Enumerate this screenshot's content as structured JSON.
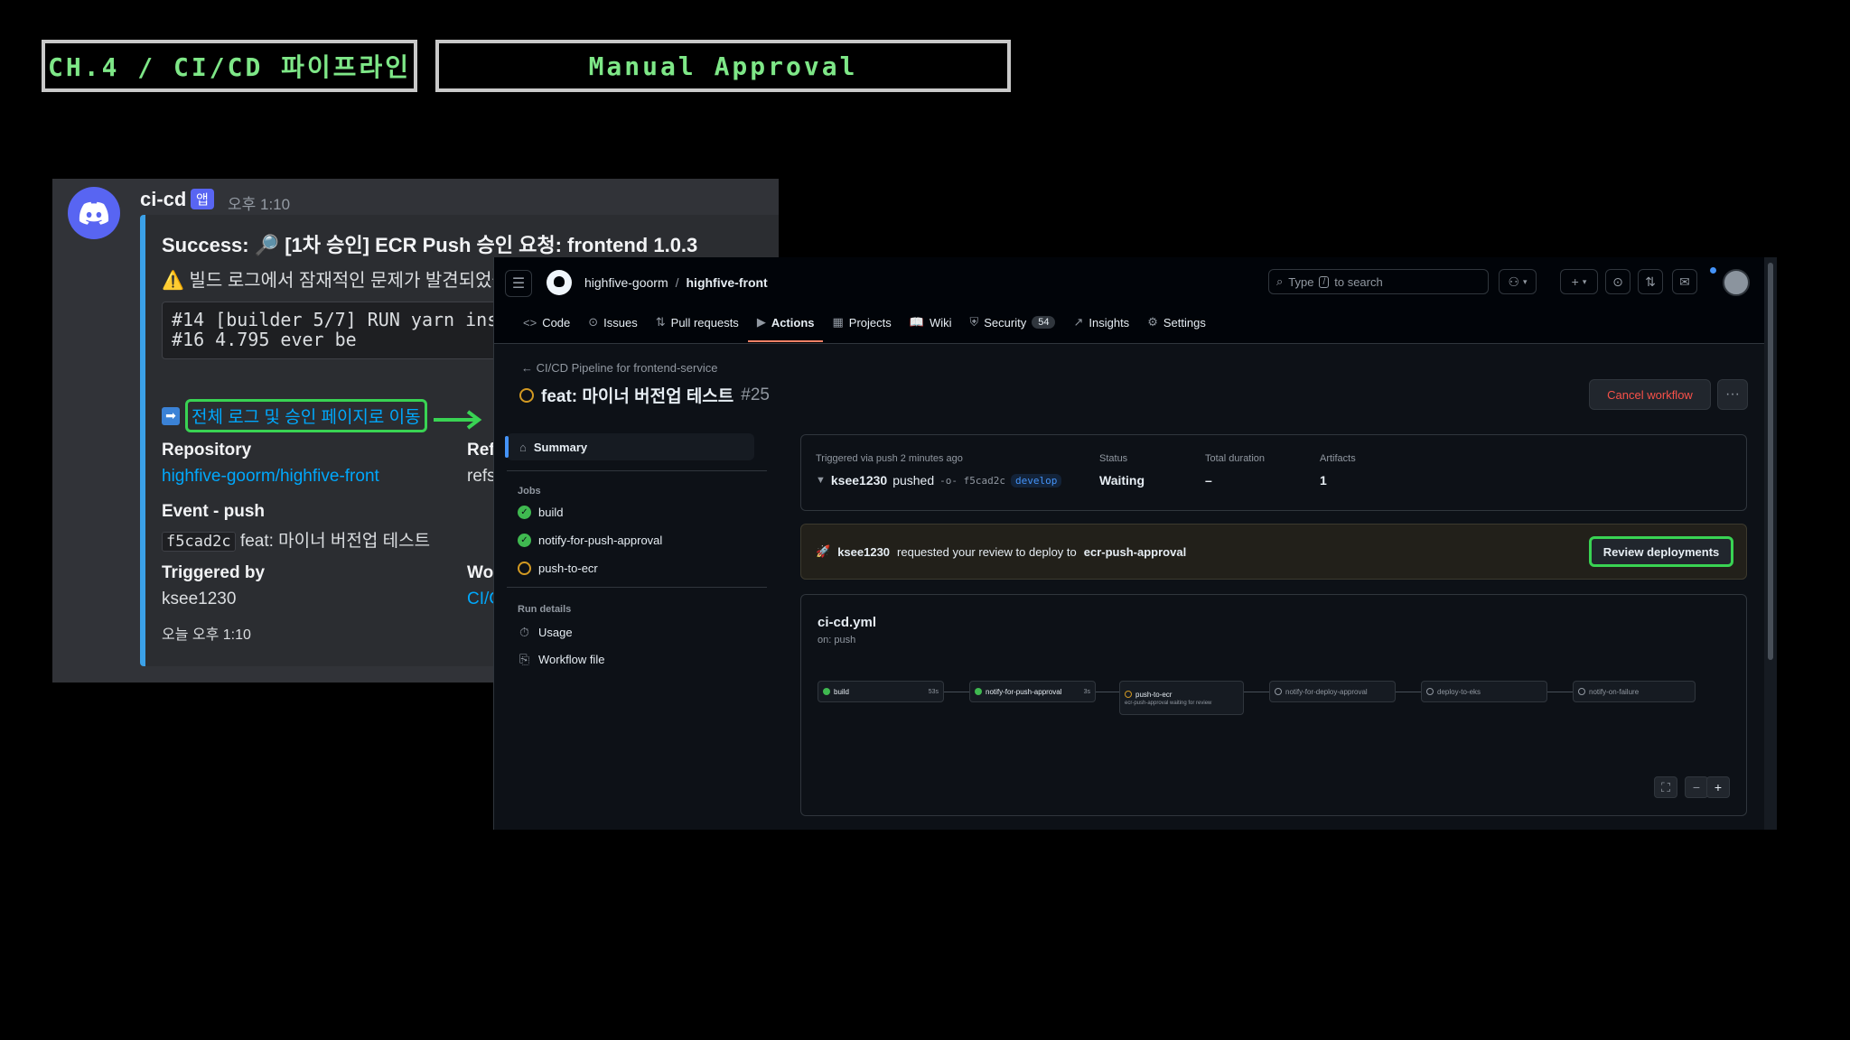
{
  "tags": {
    "chapter": "CH.4 / CI/CD 파이프라인",
    "topic": "Manual Approval"
  },
  "discord": {
    "author": "ci-cd",
    "badge": "앱",
    "time": "오후 1:10",
    "embed": {
      "title": "Success: 🔎 [1차 승인] ECR Push 승인 요청: frontend 1.0.3",
      "warning": "빌드 로그에서 잠재적인 문제가 발견되었습니",
      "code_line1": "#14 [builder 5/7] RUN yarn ins",
      "code_line2": "#16 4.795 ever be",
      "link_text": "전체 로그 및 승인 페이지로 이동",
      "repository_label": "Repository",
      "repository_value": "highfive-goorm/highfive-front",
      "ref_label": "Ref",
      "ref_value": "refs",
      "event_label": "Event - push",
      "commit_sha": "f5cad2c",
      "commit_msg": "feat: 마이너 버전업 테스트",
      "triggered_label": "Triggered by",
      "triggered_value": "ksee1230",
      "workflow_label": "Wor",
      "workflow_value": "CI/C",
      "footer": "오늘 오후 1:10"
    }
  },
  "github": {
    "owner": "highfive-goorm",
    "repo": "highfive-front",
    "search_placeholder": "Type",
    "search_key": "/",
    "search_suffix": "to search",
    "tabs": [
      {
        "label": "Code",
        "icon": "<>"
      },
      {
        "label": "Issues",
        "icon": "⊙"
      },
      {
        "label": "Pull requests",
        "icon": "⇅"
      },
      {
        "label": "Actions",
        "icon": "▶"
      },
      {
        "label": "Projects",
        "icon": "▦"
      },
      {
        "label": "Wiki",
        "icon": "📖"
      },
      {
        "label": "Security",
        "icon": "⛨",
        "counter": "54"
      },
      {
        "label": "Insights",
        "icon": "↗"
      },
      {
        "label": "Settings",
        "icon": "⚙"
      }
    ],
    "back_link": "CI/CD Pipeline for frontend-service",
    "run_title": "feat: 마이너 버전업 테스트",
    "run_number": "#25",
    "cancel_label": "Cancel workflow",
    "more_label": "···",
    "sidebar": {
      "summary": "Summary",
      "jobs_head": "Jobs",
      "jobs": [
        "build",
        "notify-for-push-approval",
        "push-to-ecr"
      ],
      "details_head": "Run details",
      "usage": "Usage",
      "workflow_file": "Workflow file"
    },
    "summary": {
      "trigger_label": "Triggered via push 2 minutes ago",
      "actor": "ksee1230",
      "action": "pushed",
      "sha": "f5cad2c",
      "branch": "develop",
      "status_label": "Status",
      "status_value": "Waiting",
      "duration_label": "Total duration",
      "duration_value": "–",
      "artifacts_label": "Artifacts",
      "artifacts_value": "1"
    },
    "review": {
      "actor": "ksee1230",
      "text": "requested your review to deploy to",
      "env": "ecr-push-approval",
      "button": "Review deployments"
    },
    "graph": {
      "file": "ci-cd.yml",
      "trigger": "on: push",
      "jobs": [
        {
          "name": "build",
          "duration": "53s",
          "state": "done"
        },
        {
          "name": "notify-for-push-approval",
          "duration": "3s",
          "state": "done"
        },
        {
          "name": "push-to-ecr",
          "note": "ecr-push-approval waiting for review",
          "state": "waiting"
        },
        {
          "name": "notify-for-deploy-approval",
          "state": "pending"
        },
        {
          "name": "deploy-to-eks",
          "state": "pending"
        },
        {
          "name": "notify-on-failure",
          "state": "pending"
        }
      ]
    }
  }
}
